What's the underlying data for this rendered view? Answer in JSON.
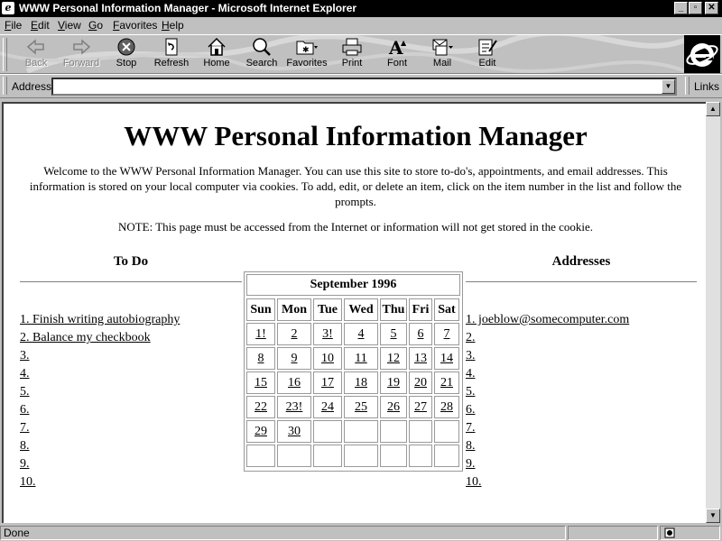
{
  "window": {
    "title": "WWW Personal Information Manager - Microsoft Internet Explorer"
  },
  "menu": [
    "File",
    "Edit",
    "View",
    "Go",
    "Favorites",
    "Help"
  ],
  "toolbar": {
    "back": "Back",
    "forward": "Forward",
    "stop": "Stop",
    "refresh": "Refresh",
    "home": "Home",
    "search": "Search",
    "favorites": "Favorites",
    "print": "Print",
    "font": "Font",
    "mail": "Mail",
    "edit": "Edit"
  },
  "address": {
    "label": "Address",
    "value": "",
    "links": "Links"
  },
  "page": {
    "title": "WWW Personal Information Manager",
    "intro": "Welcome to the WWW Personal Information Manager. You can use this site to store to-do's, appointments, and email addresses. This information is stored on your local computer via cookies. To add, edit, or delete an item, click on the item number in the list and follow the prompts.",
    "note": "NOTE: This page must be accessed from the Internet or information will not get stored in the cookie.",
    "todo_heading": "To Do",
    "addresses_heading": "Addresses",
    "todo": [
      "1. Finish writing autobiography",
      "2. Balance my checkbook",
      "3. ",
      "4. ",
      "5. ",
      "6. ",
      "7. ",
      "8. ",
      "9. ",
      "10. "
    ],
    "addresses": [
      "1. joeblow@somecomputer.com",
      "2. ",
      "3. ",
      "4. ",
      "5. ",
      "6. ",
      "7. ",
      "8. ",
      "9. ",
      "10. "
    ]
  },
  "calendar": {
    "month": "September 1996",
    "days": [
      "Sun",
      "Mon",
      "Tue",
      "Wed",
      "Thu",
      "Fri",
      "Sat"
    ],
    "weeks": [
      [
        "1!",
        "2",
        "3!",
        "4",
        "5",
        "6",
        "7"
      ],
      [
        "8",
        "9",
        "10",
        "11",
        "12",
        "13",
        "14"
      ],
      [
        "15",
        "16",
        "17",
        "18",
        "19",
        "20",
        "21"
      ],
      [
        "22",
        "23!",
        "24",
        "25",
        "26",
        "27",
        "28"
      ],
      [
        "29",
        "30",
        "",
        "",
        "",
        "",
        ""
      ],
      [
        "",
        "",
        "",
        "",
        "",
        "",
        ""
      ]
    ]
  },
  "status": {
    "text": "Done"
  }
}
